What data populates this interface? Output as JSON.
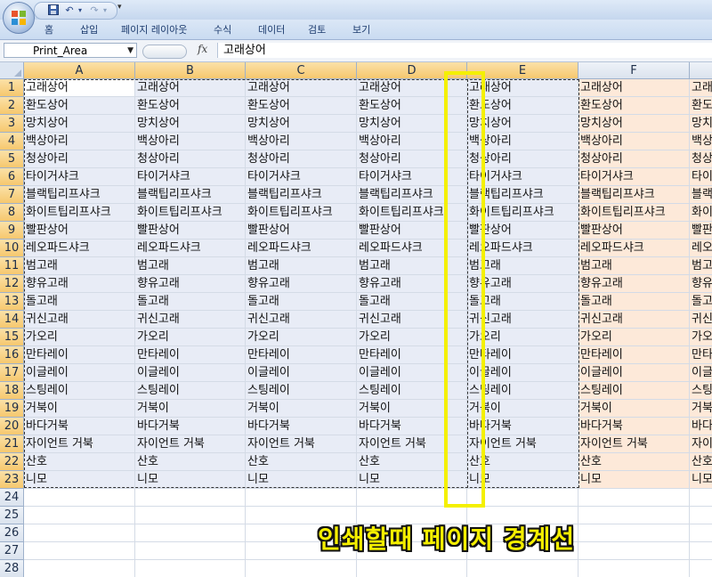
{
  "quick_access": {
    "save": "save-icon",
    "undo": "undo-icon",
    "redo": "redo-icon",
    "customize": "▾"
  },
  "ribbon_tabs": [
    "홈",
    "삽입",
    "페이지 레이아웃",
    "수식",
    "데이터",
    "검토",
    "보기"
  ],
  "formula_bar": {
    "name_box": "Print_Area",
    "fx_label": "fx",
    "formula_value": "고래상어"
  },
  "columns": [
    "A",
    "B",
    "C",
    "D",
    "E",
    "F"
  ],
  "rows": [
    {
      "num": "1",
      "value": "고래상어"
    },
    {
      "num": "2",
      "value": "환도상어"
    },
    {
      "num": "3",
      "value": "망치상어"
    },
    {
      "num": "4",
      "value": "백상아리"
    },
    {
      "num": "5",
      "value": "청상아리"
    },
    {
      "num": "6",
      "value": "타이거샤크"
    },
    {
      "num": "7",
      "value": "블랙팁리프샤크"
    },
    {
      "num": "8",
      "value": "화이트팁리프샤크"
    },
    {
      "num": "9",
      "value": "빨판상어"
    },
    {
      "num": "10",
      "value": "레오파드샤크"
    },
    {
      "num": "11",
      "value": "범고래"
    },
    {
      "num": "12",
      "value": "향유고래"
    },
    {
      "num": "13",
      "value": "돌고래"
    },
    {
      "num": "14",
      "value": "귀신고래"
    },
    {
      "num": "15",
      "value": "가오리"
    },
    {
      "num": "16",
      "value": "만타레이"
    },
    {
      "num": "17",
      "value": "이글레이"
    },
    {
      "num": "18",
      "value": "스팅레이"
    },
    {
      "num": "19",
      "value": "거북이"
    },
    {
      "num": "20",
      "value": "바다거북"
    },
    {
      "num": "21",
      "value": "자이언트 거북"
    },
    {
      "num": "22",
      "value": "산호"
    },
    {
      "num": "23",
      "value": "니모"
    }
  ],
  "empty_rows": [
    "24",
    "25",
    "26",
    "27",
    "28"
  ],
  "annotation": "인쇄할때 페이지 경계선",
  "colors": {
    "selection_fill": "#e8ecf6",
    "outside_fill": "#fde9d9",
    "header_selected": "#f6c86e",
    "highlight": "#f4f000"
  }
}
